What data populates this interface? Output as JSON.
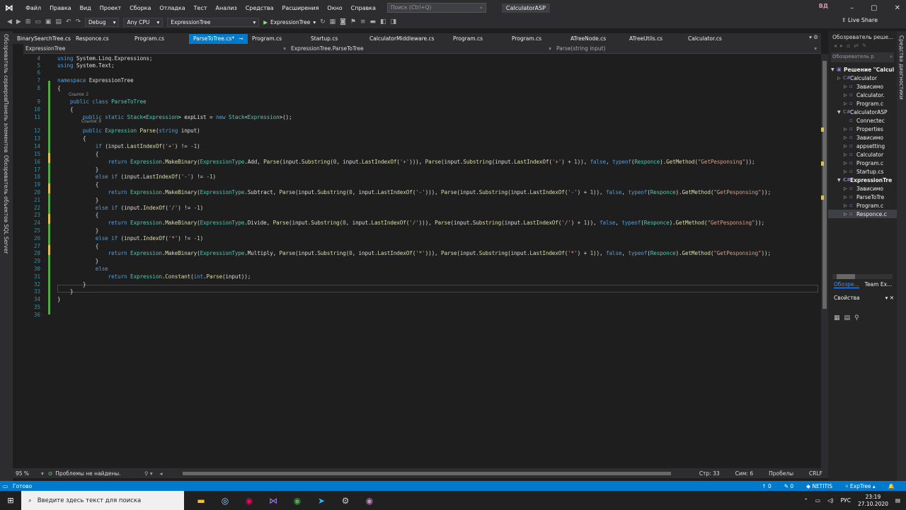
{
  "menu": {
    "items": [
      "Файл",
      "Правка",
      "Вид",
      "Проект",
      "Сборка",
      "Отладка",
      "Тест",
      "Анализ",
      "Средства",
      "Расширения",
      "Окно",
      "Справка"
    ],
    "search_placeholder": "Поиск (Ctrl+Q)",
    "solution_title": "CalculatorASP",
    "user_initials": "ВД",
    "window_controls": [
      "–",
      "▢",
      "✕"
    ]
  },
  "toolbar": {
    "config": "Debug",
    "platform": "Any CPU",
    "startup_project": "ExpressionTree",
    "run_label": "ExpressionTree",
    "live_share": "Live Share"
  },
  "left_strip": [
    "Обозреватель серверов",
    "Панель элементов",
    "Обозреватель объектов SQL Server"
  ],
  "right_strip": "Средства диагностики",
  "tabs": [
    {
      "label": "BinarySearchTree.cs",
      "active": false
    },
    {
      "label": "Responce.cs",
      "active": false
    },
    {
      "label": "Program.cs",
      "active": false
    },
    {
      "label": "ParseToTree.cs*",
      "active": true
    },
    {
      "label": "Program.cs",
      "active": false
    },
    {
      "label": "Startup.cs",
      "active": false
    },
    {
      "label": "CalculatorMiddleware.cs",
      "active": false
    },
    {
      "label": "Program.cs",
      "active": false
    },
    {
      "label": "Program.cs",
      "active": false
    },
    {
      "label": "ATreeNode.cs",
      "active": false
    },
    {
      "label": "ATreeUtils.cs",
      "active": false
    },
    {
      "label": "Calculator.cs",
      "active": false
    }
  ],
  "navbar": {
    "project": "ExpressionTree",
    "type": "ExpressionTree.ParseToTree",
    "member": "Parse(string input)"
  },
  "code": {
    "line_numbers": [
      "4",
      "5",
      "6",
      "7",
      "8",
      "9",
      "10",
      "11",
      "12",
      "13",
      "14",
      "15",
      "16",
      "17",
      "18",
      "19",
      "20",
      "21",
      "22",
      "23",
      "24",
      "25",
      "26",
      "27",
      "28",
      "29",
      "30",
      "31",
      "32",
      "33",
      "34",
      "35",
      "36"
    ],
    "lens_refs_class": "Ссылок: 2",
    "lens_refs_method": "Ссылок: 9"
  },
  "solution_explorer": {
    "title": "Обозреватель реше...",
    "search_placeholder": "Обозреватель р",
    "nodes": [
      {
        "label": "Решение \"Calcul",
        "depth": 0,
        "bold": true
      },
      {
        "label": "Calculator",
        "depth": 1
      },
      {
        "label": "Зависимо",
        "depth": 2
      },
      {
        "label": "Calculator.",
        "depth": 2
      },
      {
        "label": "Program.c",
        "depth": 2
      },
      {
        "label": "CalculatorASP",
        "depth": 1
      },
      {
        "label": "Connectec",
        "depth": 2
      },
      {
        "label": "Properties",
        "depth": 2
      },
      {
        "label": "Зависимо",
        "depth": 2
      },
      {
        "label": "appsetting",
        "depth": 2
      },
      {
        "label": "Calculator",
        "depth": 2
      },
      {
        "label": "Program.c",
        "depth": 2
      },
      {
        "label": "Startup.cs",
        "depth": 2
      },
      {
        "label": "ExpressionTre",
        "depth": 1,
        "bold": true
      },
      {
        "label": "Зависимо",
        "depth": 2
      },
      {
        "label": "ParseToTre",
        "depth": 2
      },
      {
        "label": "Program.c",
        "depth": 2
      },
      {
        "label": "Responce.c",
        "depth": 2,
        "selected": true
      }
    ],
    "bottom_tabs": [
      "Обозре...",
      "Team Ex..."
    ],
    "properties_title": "Свойства"
  },
  "editor_status": {
    "zoom": "95 %",
    "problems": "Проблемы не найдены.",
    "line": "Стр: 33",
    "col": "Сим: 6",
    "spaces": "Пробелы",
    "eol": "CRLF"
  },
  "status": {
    "ready": "Готово",
    "up": "0",
    "pencil": "0",
    "repo": "NETITIS",
    "branch": "ExpTree",
    "bell": "🔔"
  },
  "taskbar": {
    "search_placeholder": "Введите здесь текст для поиска",
    "lang": "РУС",
    "time": "23:19",
    "date": "27.10.2020"
  },
  "colors": {
    "accent": "#007acc",
    "background": "#1e1e1e",
    "chrome": "#2d2d30"
  }
}
